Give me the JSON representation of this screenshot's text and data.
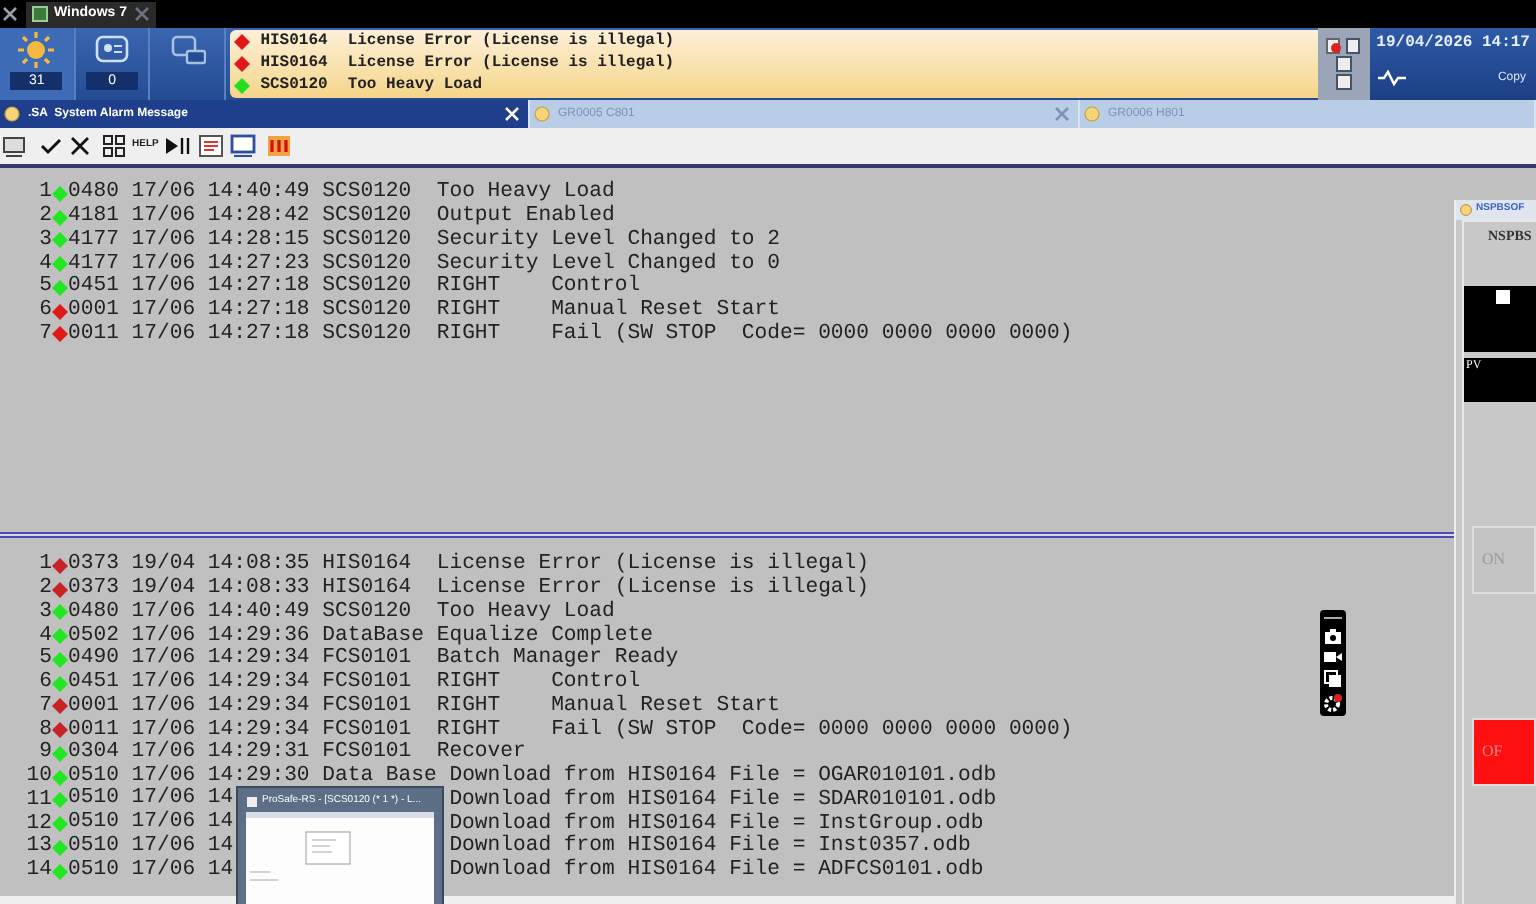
{
  "host_tab": {
    "label": "Windows 7"
  },
  "header": {
    "counters": [
      {
        "kind": "sun",
        "count": "31"
      },
      {
        "kind": "screen",
        "count": "0"
      },
      {
        "kind": "monitor"
      }
    ]
  },
  "alarm_banner": [
    {
      "color": "#e01818",
      "station": "HIS0164",
      "message": "License Error (License is illegal)"
    },
    {
      "color": "#e01818",
      "station": "HIS0164",
      "message": "License Error (License is illegal)"
    },
    {
      "color": "#20e020",
      "station": "SCS0120",
      "message": "Too Heavy Load"
    }
  ],
  "clock": {
    "datetime": "19/04/2026 14:17",
    "copy_label": "Copy"
  },
  "tabs": [
    {
      "label": ".SA  System Alarm Message",
      "selected": true
    },
    {
      "label": "GR0005 C801",
      "selected": false
    },
    {
      "label": "GR0006 H801",
      "selected": false
    }
  ],
  "toolbar": {
    "help_label": "HELP"
  },
  "upper_list": [
    {
      "index": "1",
      "color": "#22e622",
      "text": "0480 17/06 14:40:49 SCS0120  Too Heavy Load"
    },
    {
      "index": "2",
      "color": "#22e622",
      "text": "4181 17/06 14:28:42 SCS0120  Output Enabled"
    },
    {
      "index": "3",
      "color": "#22e622",
      "text": "4177 17/06 14:28:15 SCS0120  Security Level Changed to 2"
    },
    {
      "index": "4",
      "color": "#22e622",
      "text": "4177 17/06 14:27:23 SCS0120  Security Level Changed to 0"
    },
    {
      "index": "5",
      "color": "#22e622",
      "text": "0451 17/06 14:27:18 SCS0120  RIGHT    Control"
    },
    {
      "index": "6",
      "color": "#e01818",
      "text": "0001 17/06 14:27:18 SCS0120  RIGHT    Manual Reset Start"
    },
    {
      "index": "7",
      "color": "#e01818",
      "text": "0011 17/06 14:27:18 SCS0120  RIGHT    Fail (SW STOP  Code= 0000 0000 0000 0000)"
    }
  ],
  "lower_list": [
    {
      "index": "1",
      "color": "#c42424",
      "text": "0373 19/04 14:08:35 HIS0164  License Error (License is illegal)"
    },
    {
      "index": "2",
      "color": "#c42424",
      "text": "0373 19/04 14:08:33 HIS0164  License Error (License is illegal)"
    },
    {
      "index": "3",
      "color": "#22e622",
      "text": "0480 17/06 14:40:49 SCS0120  Too Heavy Load"
    },
    {
      "index": "4",
      "color": "#22e622",
      "text": "0502 17/06 14:29:36 DataBase Equalize Complete"
    },
    {
      "index": "5",
      "color": "#22e622",
      "text": "0490 17/06 14:29:34 FCS0101  Batch Manager Ready"
    },
    {
      "index": "6",
      "color": "#22e622",
      "text": "0451 17/06 14:29:34 FCS0101  RIGHT    Control"
    },
    {
      "index": "7",
      "color": "#c42424",
      "text": "0001 17/06 14:29:34 FCS0101  RIGHT    Manual Reset Start"
    },
    {
      "index": "8",
      "color": "#c42424",
      "text": "0011 17/06 14:29:34 FCS0101  RIGHT    Fail (SW STOP  Code= 0000 0000 0000 0000)"
    },
    {
      "index": "9",
      "color": "#22e622",
      "text": "0304 17/06 14:29:31 FCS0101  Recover"
    },
    {
      "index": "10",
      "color": "#22e622",
      "text": "0510 17/06 14:29:30 Data Base Download from HIS0164 File = OGAR010101.odb"
    },
    {
      "index": "11",
      "color": "#22e622",
      "text": "0510 17/06 14",
      "text_after": "Download from HIS0164 File = SDAR010101.odb"
    },
    {
      "index": "12",
      "color": "#22e622",
      "text": "0510 17/06 14",
      "text_after": "Download from HIS0164 File = InstGroup.odb"
    },
    {
      "index": "13",
      "color": "#22e622",
      "text": "0510 17/06 14",
      "text_after": "Download from HIS0164 File = Inst0357.odb"
    },
    {
      "index": "14",
      "color": "#22e622",
      "text": "0510 17/06 14",
      "text_after": "Download from HIS0164 File = ADFCS0101.odb"
    }
  ],
  "thumbnail_popup": {
    "title": "ProSafe-RS - [SCS0120 (* 1 *) - L..."
  },
  "faceplate": {
    "title": "NSPBSOF",
    "tag": "NSPBS",
    "pv_label": "PV",
    "buttons": [
      {
        "label": "ON",
        "lit": false
      },
      {
        "label": "OF",
        "lit": true
      }
    ]
  }
}
